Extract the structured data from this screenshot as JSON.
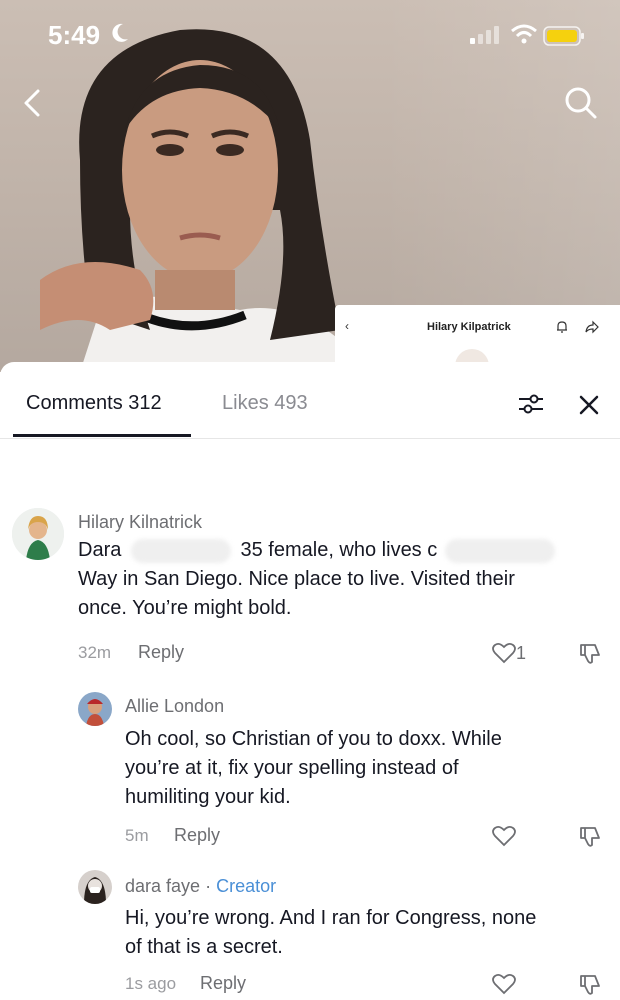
{
  "status_bar": {
    "time": "5:49"
  },
  "mini_profile": {
    "name": "Hilary Kilpatrick"
  },
  "tabs": {
    "comments": "Comments 312",
    "likes": "Likes 493"
  },
  "comments": [
    {
      "author": "Hilary Kilnatrick",
      "text_start": "Dara",
      "text_mid": "35 female, who lives c",
      "text_rest_1": "Way in San Diego. Nice place to live. Visited their",
      "text_rest_2": "once. You’re might bold.",
      "time": "32m",
      "reply": "Reply",
      "likes": "1"
    },
    {
      "author": "Allie London",
      "text_lines": [
        "Oh cool, so Christian of you to doxx. While",
        "you’re at it, fix your spelling instead of",
        "humiliting your kid."
      ],
      "time": "5m",
      "reply": "Reply"
    },
    {
      "author": "dara faye",
      "separator": "·",
      "badge": "Creator",
      "text_lines": [
        "Hi, you’re wrong. And I ran for Congress, none",
        "of that is a secret."
      ],
      "time": "1s ago",
      "reply": "Reply"
    }
  ],
  "colors": {
    "creator_badge": "#4a8fd6",
    "text": "#161823",
    "muted": "#6d6e72"
  }
}
